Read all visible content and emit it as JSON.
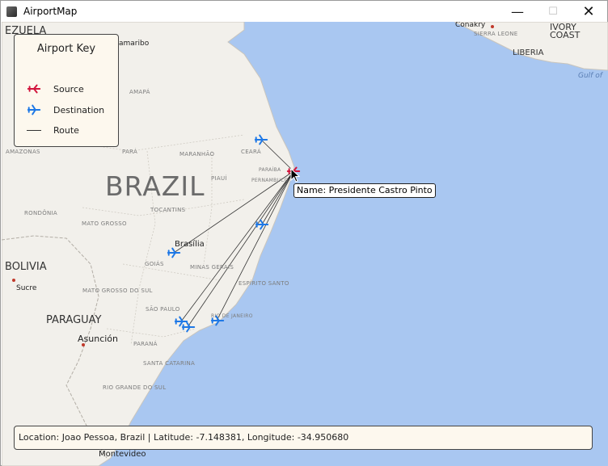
{
  "window": {
    "title": "AirportMap",
    "minimize_glyph": "—",
    "maximize_glyph": "☐",
    "close_glyph": "✕"
  },
  "map_labels": {
    "brazil": "BRAZIL",
    "bolivia": "BOLIVIA",
    "paraguay": "PARAGUAY",
    "venezuela": "EZUELA",
    "liberia": "LIBERIA",
    "ivory_coast_1": "IVORY",
    "ivory_coast_2": "COAST",
    "sierra_leone": "SIERRA LEONE",
    "conakry": "Conakry",
    "gulf": "Gulf of",
    "brasilia": "Brasília",
    "asuncion": "Asunción",
    "sucre": "Sucre",
    "montevideo": "Montevideo",
    "amarambo": "amaribo",
    "amapa": "AMAPÁ",
    "amazonas": "AMAZONAS",
    "para": "PARÁ",
    "maranhao": "MARANHÃO",
    "ceara": "CEARÁ",
    "piaui": "PIAUÍ",
    "paraiba": "PARAÍBA",
    "pernambuco": "PERNAMBUCO",
    "tocantins": "TOCANTINS",
    "rondonia": "RONDÔNIA",
    "mato_grosso": "MATO GROSSO",
    "goias": "GOIÁS",
    "minas_gerais": "MINAS GERAIS",
    "espirito_santo": "ESPÍRITO SANTO",
    "mato_grosso_do_sul": "MATO GROSSO DO SUL",
    "sao_paulo": "SÃO PAULO",
    "rio_de_janeiro": "RIO DE JANEIRO",
    "parana": "PARANÁ",
    "santa_catarina": "SANTA CATARINA",
    "rio_grande_do_sul": "RIO GRANDE DO SUL"
  },
  "legend": {
    "title": "Airport Key",
    "items": [
      {
        "label": "Source",
        "icon": "source-plane-icon",
        "color": "#d2143c"
      },
      {
        "label": "Destination",
        "icon": "destination-plane-icon",
        "color": "#1e78e6"
      },
      {
        "label": "Route",
        "icon": "route-line-icon",
        "color": "#333333"
      }
    ]
  },
  "tooltip": {
    "text": "Name: Presidente Castro Pinto"
  },
  "status": {
    "text": "Location: Joao Pessoa, Brazil | Latitude: -7.148381, Longitude: -34.950680"
  },
  "colors": {
    "ocean": "#a9c7f1",
    "land": "#f2f0eb",
    "source": "#d2143c",
    "destination": "#1e78e6",
    "panel_bg": "#fdf8ee"
  }
}
